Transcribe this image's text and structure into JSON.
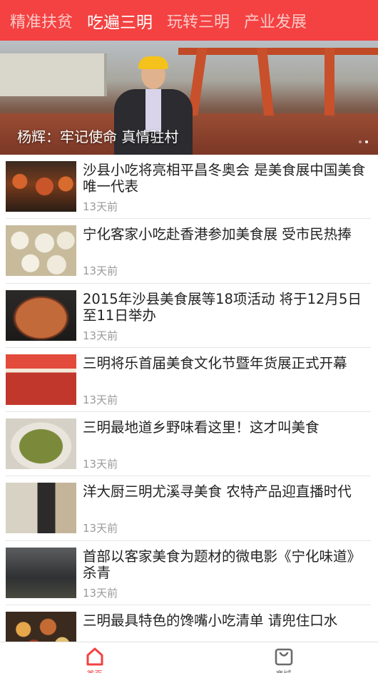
{
  "nav": {
    "tabs": [
      {
        "label": "精准扶贫",
        "active": false
      },
      {
        "label": "吃遍三明",
        "active": true
      },
      {
        "label": "玩转三明",
        "active": false
      },
      {
        "label": "产业发展",
        "active": false
      }
    ]
  },
  "banner": {
    "caption": "杨辉：牢记使命 真情驻村",
    "slide_count": 2
  },
  "articles": [
    {
      "title": "沙县小吃将亮相平昌冬奥会 是美食展中国美食唯一代表",
      "time": "13天前"
    },
    {
      "title": "宁化客家小吃赴香港参加美食展 受市民热捧",
      "time": "13天前"
    },
    {
      "title": "2015年沙县美食展等18项活动 将于12月5日至11日举办",
      "time": "13天前"
    },
    {
      "title": "三明将乐首届美食文化节暨年货展正式开幕",
      "time": "13天前"
    },
    {
      "title": "三明最地道乡野味看这里！这才叫美食",
      "time": "13天前"
    },
    {
      "title": "洋大厨三明尤溪寻美食 农特产品迎直播时代",
      "time": "13天前"
    },
    {
      "title": "首部以客家美食为题材的微电影《宁化味道》杀青",
      "time": "13天前"
    },
    {
      "title": "三明最具特色的馋嘴小吃清单 请兜住口水",
      "time": ""
    }
  ],
  "bottom_tabs": [
    {
      "label": "首页",
      "icon": "home-icon",
      "active": true
    },
    {
      "label": "商城",
      "icon": "shopping-bag-icon",
      "active": false
    }
  ],
  "colors": {
    "accent": "#f44141",
    "text": "#222222",
    "muted": "#9a9a9a"
  }
}
